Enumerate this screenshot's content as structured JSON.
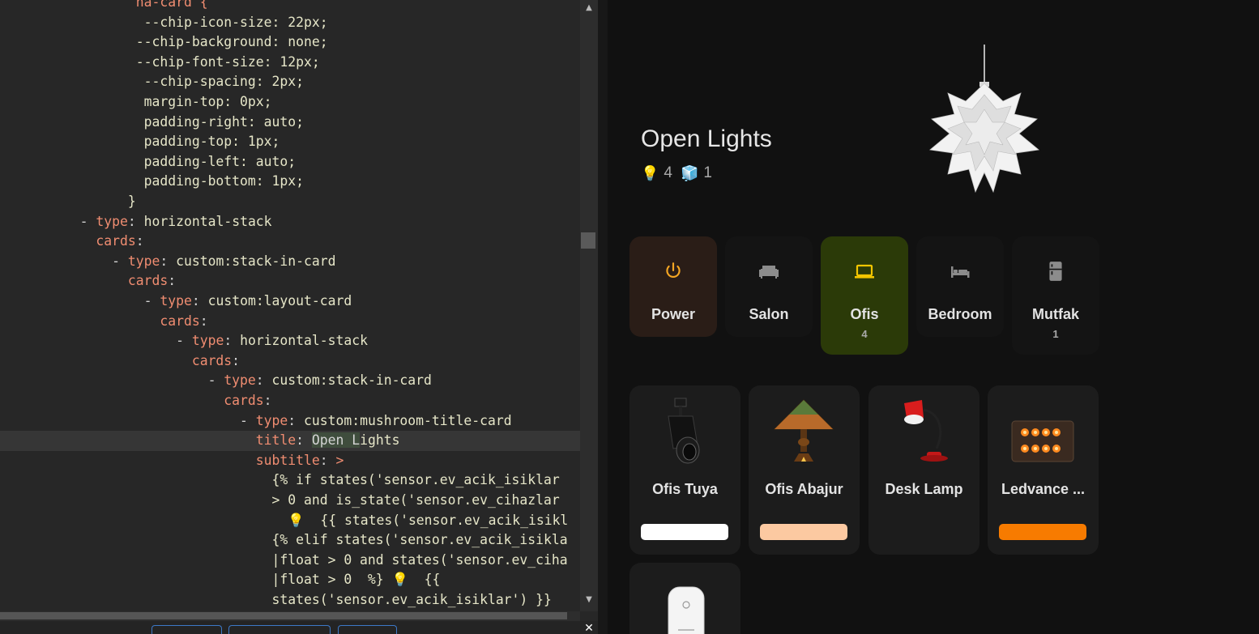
{
  "editor": {
    "lines": [
      [
        [
          "k",
          "                 ha-card {"
        ]
      ],
      [
        [
          "v",
          "                  --chip-icon-size: 22px;"
        ]
      ],
      [
        [
          "v",
          "                 --chip-background: none;"
        ]
      ],
      [
        [
          "v",
          "                 --chip-font-size: 12px;"
        ]
      ],
      [
        [
          "v",
          "                  --chip-spacing: 2px;"
        ]
      ],
      [
        [
          "v",
          "                  margin-top: 0px;"
        ]
      ],
      [
        [
          "v",
          "                  padding-right: auto;"
        ]
      ],
      [
        [
          "v",
          "                  padding-top: 1px;"
        ]
      ],
      [
        [
          "v",
          "                  padding-left: auto;"
        ]
      ],
      [
        [
          "v",
          "                  padding-bottom: 1px;"
        ]
      ],
      [
        [
          "v",
          "                }"
        ]
      ],
      [
        [
          "p",
          "          - "
        ],
        [
          "k",
          "type"
        ],
        [
          "p",
          ": "
        ],
        [
          "v",
          "horizontal-stack"
        ]
      ],
      [
        [
          "k",
          "            cards"
        ],
        [
          "p",
          ":"
        ]
      ],
      [
        [
          "p",
          "              - "
        ],
        [
          "k",
          "type"
        ],
        [
          "p",
          ": "
        ],
        [
          "v",
          "custom:stack-in-card"
        ]
      ],
      [
        [
          "k",
          "                cards"
        ],
        [
          "p",
          ":"
        ]
      ],
      [
        [
          "p",
          "                  - "
        ],
        [
          "k",
          "type"
        ],
        [
          "p",
          ": "
        ],
        [
          "v",
          "custom:layout-card"
        ]
      ],
      [
        [
          "k",
          "                    cards"
        ],
        [
          "p",
          ":"
        ]
      ],
      [
        [
          "p",
          "                      - "
        ],
        [
          "k",
          "type"
        ],
        [
          "p",
          ": "
        ],
        [
          "v",
          "horizontal-stack"
        ]
      ],
      [
        [
          "k",
          "                        cards"
        ],
        [
          "p",
          ":"
        ]
      ],
      [
        [
          "p",
          "                          - "
        ],
        [
          "k",
          "type"
        ],
        [
          "p",
          ": "
        ],
        [
          "v",
          "custom:stack-in-card"
        ]
      ],
      [
        [
          "k",
          "                            cards"
        ],
        [
          "p",
          ":"
        ]
      ],
      [
        [
          "p",
          "                              - "
        ],
        [
          "k",
          "type"
        ],
        [
          "p",
          ": "
        ],
        [
          "v",
          "custom:mushroom-title-card"
        ]
      ],
      [
        [
          "k",
          "                                title"
        ],
        [
          "p",
          ": "
        ],
        [
          "sel",
          "Open L"
        ],
        [
          "v",
          "ights"
        ]
      ],
      [
        [
          "k",
          "                                subtitle"
        ],
        [
          "p",
          ": "
        ],
        [
          "k",
          ">"
        ]
      ],
      [
        [
          "v",
          "                                  {% if states('sensor.ev_acik_isiklar"
        ]
      ],
      [
        [
          "v",
          "                                  > 0 and is_state('sensor.ev_cihazlar"
        ]
      ],
      [
        [
          "v",
          "                                    💡  {{ states('sensor.ev_acik_isikl"
        ]
      ],
      [
        [
          "v",
          "                                  {% elif states('sensor.ev_acik_isikla"
        ]
      ],
      [
        [
          "v",
          "                                  |float > 0 and states('sensor.ev_ciha"
        ]
      ],
      [
        [
          "v",
          "                                  |float > 0  %} 💡  {{"
        ]
      ],
      [
        [
          "v",
          "                                  states('sensor.ev_acik_isiklar') }}"
        ]
      ]
    ],
    "highlight_line": 22
  },
  "preview": {
    "title": "Open Lights",
    "subtitle": {
      "bulb_icon": "💡",
      "bulb_count": "4",
      "cube_icon": "🧊",
      "cube_count": "1"
    },
    "chips": [
      {
        "label": "Power",
        "count": "",
        "icon": "power-icon",
        "bg": "#2a1d17",
        "icon_color": "#f5a623"
      },
      {
        "label": "Salon",
        "count": "",
        "icon": "sofa-icon",
        "bg": "#141414",
        "icon_color": "#8c8c8c"
      },
      {
        "label": "Ofis",
        "count": "4",
        "icon": "laptop-icon",
        "bg": "#2b3a08",
        "icon_color": "#f2c500"
      },
      {
        "label": "Bedroom",
        "count": "",
        "icon": "bed-icon",
        "bg": "#141414",
        "icon_color": "#8c8c8c"
      },
      {
        "label": "Mutfak",
        "count": "1",
        "icon": "fridge-icon",
        "bg": "#141414",
        "icon_color": "#8c8c8c"
      }
    ],
    "lights": [
      {
        "name": "Ofis Tuya",
        "bar_color": "#ffffff",
        "image": "track-spotlight"
      },
      {
        "name": "Ofis Abajur",
        "bar_color": "#fcc9a1",
        "image": "tiffany-lamp"
      },
      {
        "name": "Desk Lamp",
        "bar_color": "",
        "image": "desk-lamp"
      },
      {
        "name": "Ledvance ...",
        "bar_color": "#f77b00",
        "image": "led-floodlight"
      },
      {
        "name": "",
        "bar_color": "",
        "image": "smart-plug"
      }
    ]
  }
}
